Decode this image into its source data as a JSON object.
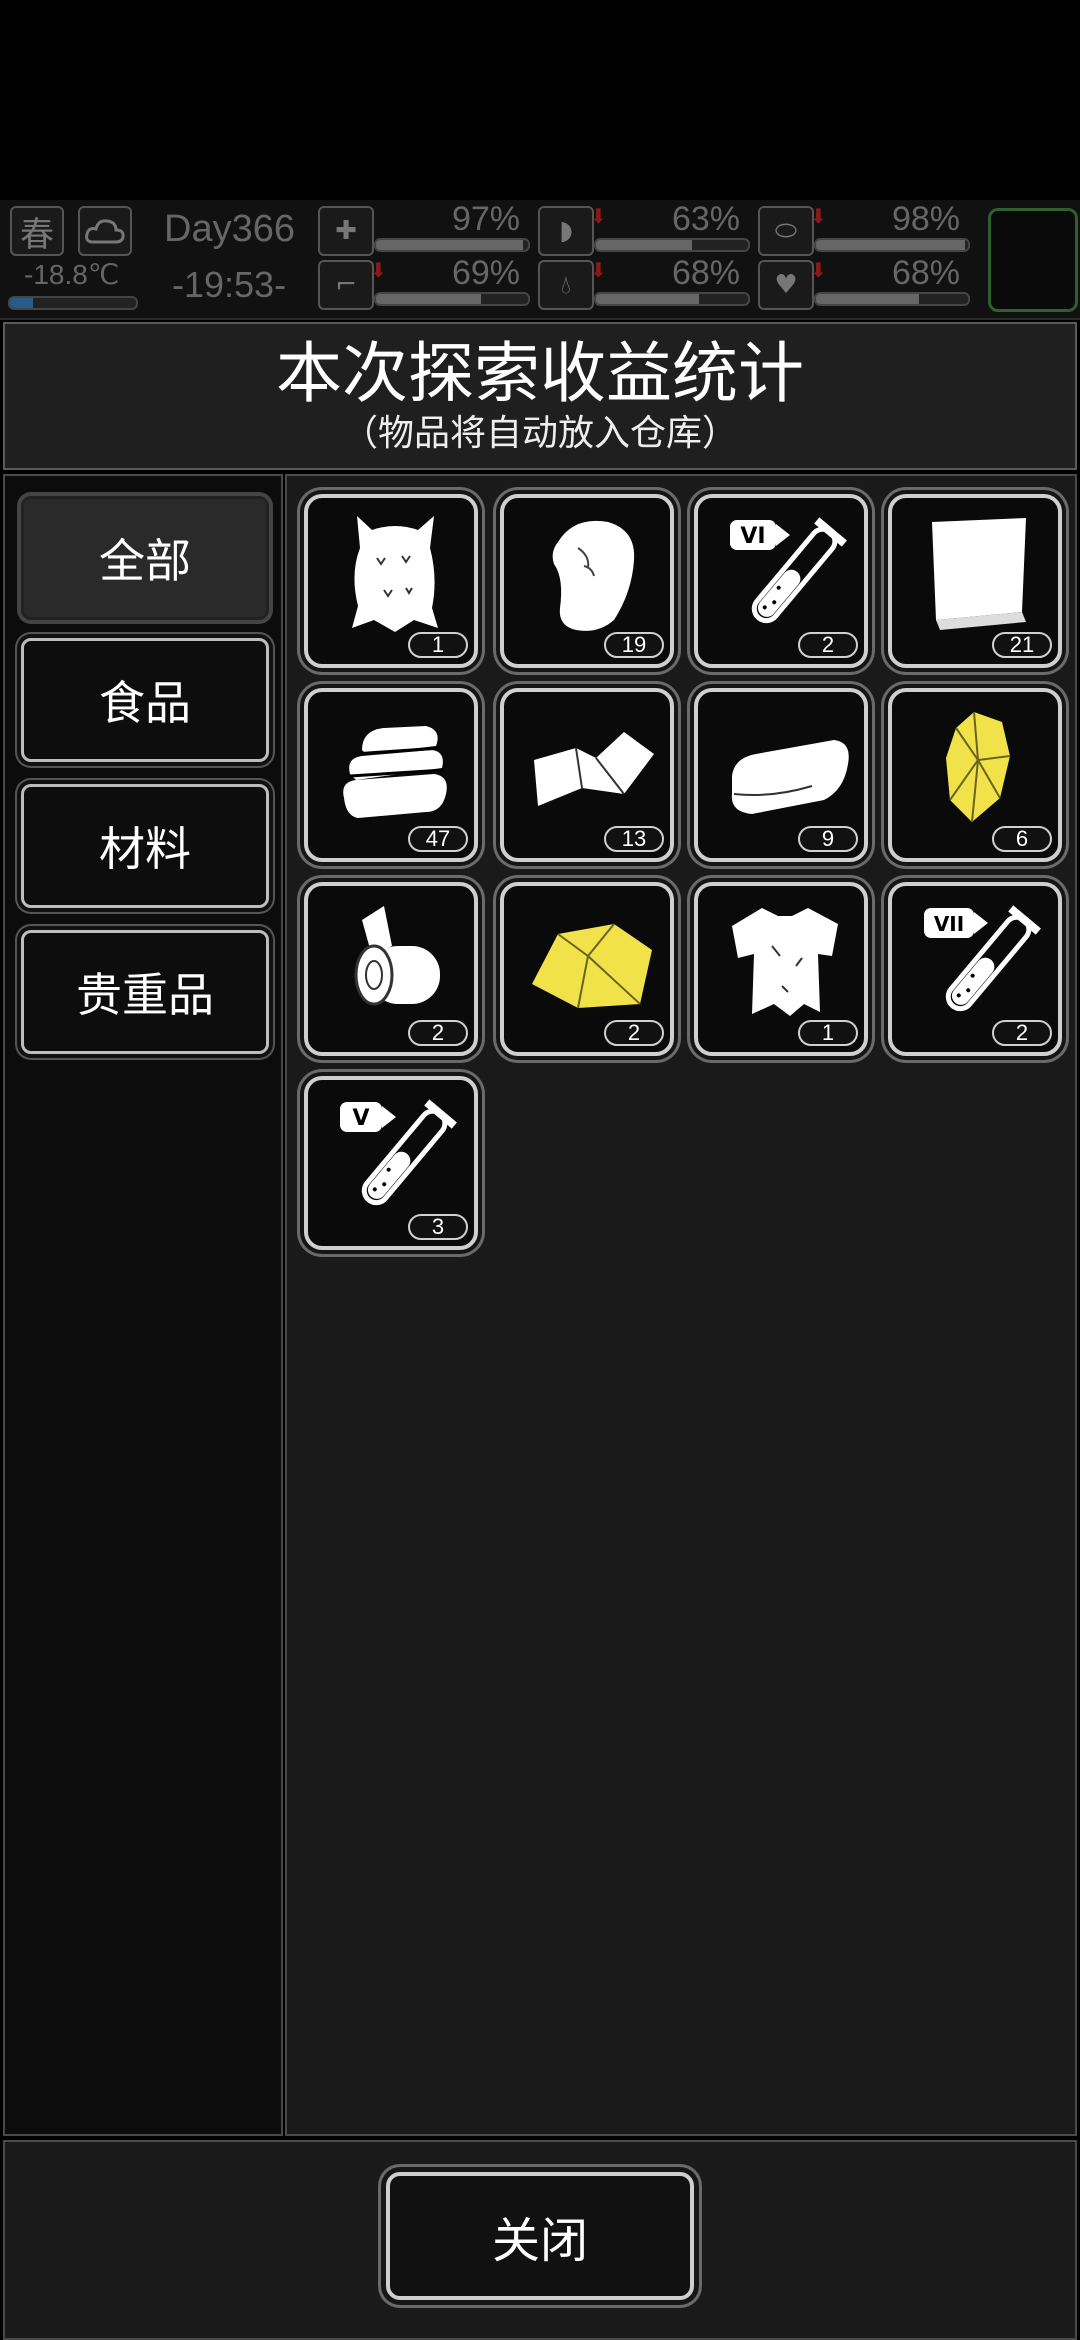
{
  "status": {
    "season": "春",
    "weather_icon": "cloud-icon",
    "temperature": "-18.8℃",
    "day": "Day366",
    "time": "-19:53-",
    "stats": [
      {
        "name": "health",
        "icon": "medkit-icon",
        "value": "97%",
        "level": 0.97
      },
      {
        "name": "hunger",
        "icon": "stomach-icon",
        "value": "63%",
        "level": 0.63
      },
      {
        "name": "pill",
        "icon": "pill-icon",
        "value": "98%",
        "level": 0.98
      },
      {
        "name": "stamina",
        "icon": "boot-icon",
        "value": "69%",
        "level": 0.69
      },
      {
        "name": "thirst",
        "icon": "water-drop-icon",
        "value": "68%",
        "level": 0.68
      },
      {
        "name": "mood",
        "icon": "heart-icon",
        "value": "68%",
        "level": 0.68
      }
    ]
  },
  "dialog": {
    "title": "本次探索收益统计",
    "subtitle": "（物品将自动放入仓库）"
  },
  "categories": [
    {
      "label": "全部",
      "active": true
    },
    {
      "label": "食品",
      "active": false
    },
    {
      "label": "材料",
      "active": false
    },
    {
      "label": "贵重品",
      "active": false
    }
  ],
  "items": [
    {
      "icon": "fur-pelt-icon",
      "count": "1"
    },
    {
      "icon": "leather-hide-icon",
      "count": "19"
    },
    {
      "icon": "potion-vi-icon",
      "label": "VI",
      "count": "2"
    },
    {
      "icon": "paper-sheets-icon",
      "count": "21"
    },
    {
      "icon": "folded-towels-icon",
      "count": "47"
    },
    {
      "icon": "folded-cloth-icon",
      "count": "13"
    },
    {
      "icon": "rolled-fabric-icon",
      "count": "9"
    },
    {
      "icon": "yellow-crystal-icon",
      "count": "6"
    },
    {
      "icon": "bandage-roll-icon",
      "count": "2"
    },
    {
      "icon": "yellow-cloth-icon",
      "count": "2"
    },
    {
      "icon": "torn-shirt-icon",
      "count": "1"
    },
    {
      "icon": "potion-vii-icon",
      "label": "VII",
      "count": "2"
    },
    {
      "icon": "potion-v-icon",
      "label": "V",
      "count": "3"
    }
  ],
  "footer": {
    "close_label": "关闭"
  },
  "colors": {
    "accent_yellow": "#f2e24a",
    "slot_border": "#cfcfcf",
    "panel_bg": "#1a1a1a"
  }
}
